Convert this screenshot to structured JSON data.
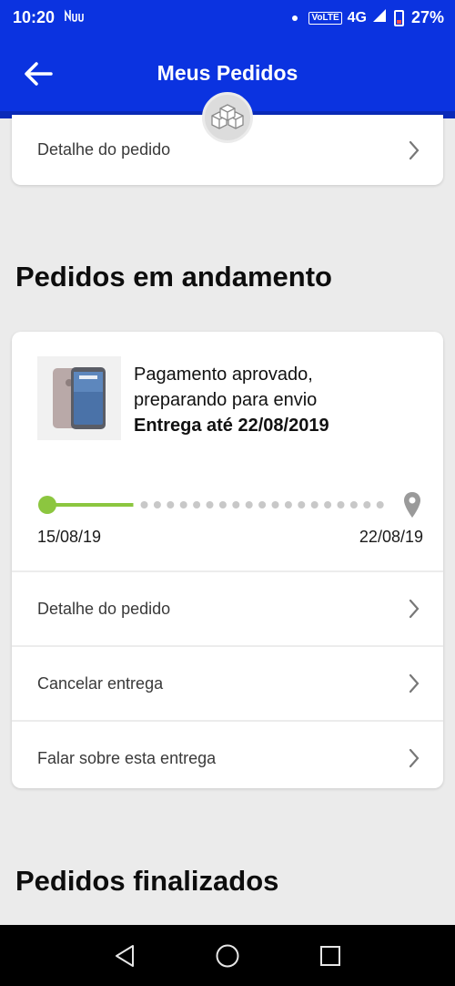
{
  "status_bar": {
    "time": "10:20",
    "volte": "VoLTE",
    "network": "4G",
    "battery": "27%"
  },
  "header": {
    "title": "Meus Pedidos"
  },
  "top_card": {
    "row_label": "Detalhe do pedido"
  },
  "in_progress": {
    "section_title": "Pedidos em andamento",
    "order": {
      "status_line1": "Pagamento aprovado,",
      "status_line2": "preparando para envio",
      "delivery": "Entrega até 22/08/2019",
      "start_date": "15/08/19",
      "end_date": "22/08/19",
      "progress": 0.25
    },
    "rows": [
      {
        "label": "Detalhe do pedido"
      },
      {
        "label": "Cancelar entrega"
      },
      {
        "label": "Falar sobre esta entrega"
      }
    ]
  },
  "finished": {
    "section_title": "Pedidos finalizados"
  },
  "colors": {
    "brand_blue": "#0b33e0",
    "progress_green": "#8cc63f",
    "background": "#ebebeb"
  },
  "icons": [
    "back-arrow-icon",
    "box-icon",
    "chevron-right-icon",
    "location-pin-icon",
    "back-nav-icon",
    "home-nav-icon",
    "recents-nav-icon"
  ]
}
